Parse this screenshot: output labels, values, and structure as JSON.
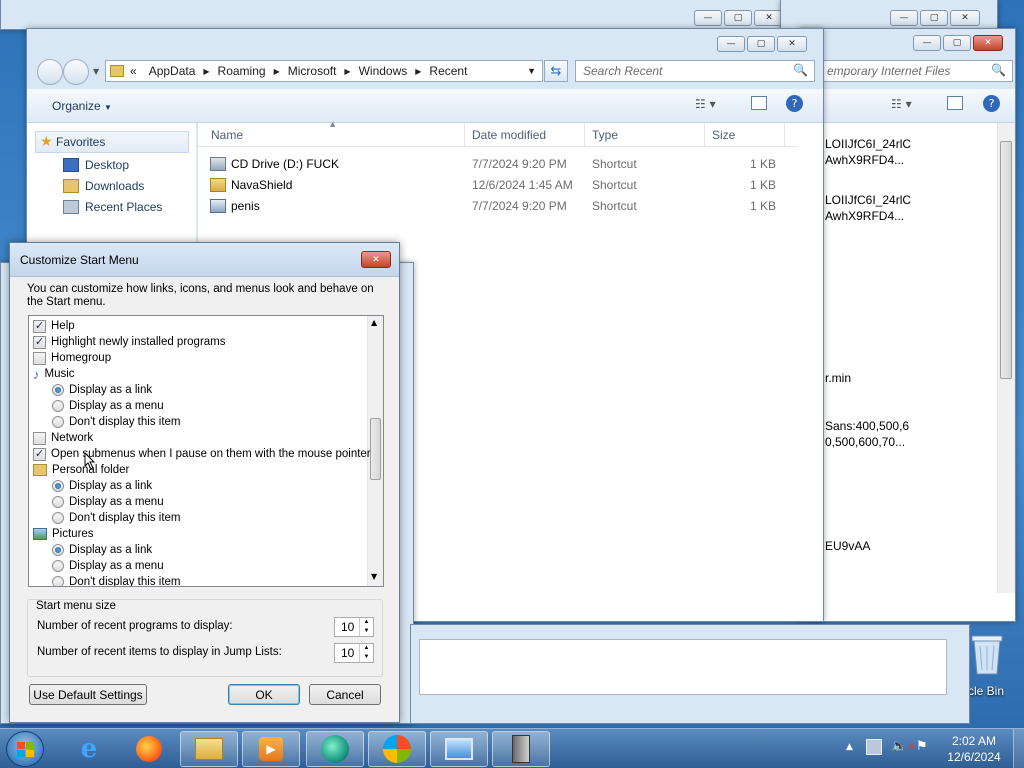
{
  "explorer": {
    "address": {
      "prefix": "«",
      "crumbs": [
        "AppData",
        "Roaming",
        "Microsoft",
        "Windows",
        "Recent"
      ]
    },
    "search_placeholder": "Search Recent",
    "organize_label": "Organize",
    "nav": {
      "favorites": "Favorites",
      "items": [
        "Desktop",
        "Downloads",
        "Recent Places"
      ]
    },
    "columns": [
      "Name",
      "Date modified",
      "Type",
      "Size"
    ],
    "files": [
      {
        "name": "CD Drive (D:) FUCK",
        "date": "7/7/2024 9:20 PM",
        "type": "Shortcut",
        "size": "1 KB"
      },
      {
        "name": "NavaShield",
        "date": "12/6/2024 1:45 AM",
        "type": "Shortcut",
        "size": "1 KB"
      },
      {
        "name": "penis",
        "date": "7/7/2024 9:20 PM",
        "type": "Shortcut",
        "size": "1 KB"
      }
    ]
  },
  "back_window": {
    "search_placeholder": "emporary Internet Files",
    "lines": [
      "LOIIJfC6I_24rlC",
      "AwhX9RFD4...",
      "LOIIJfC6I_24rlC",
      "AwhX9RFD4...",
      "r.min",
      "Sans:400,500,6",
      "0,500,600,70...",
      "EU9vAA"
    ]
  },
  "dialog": {
    "title": "Customize Start Menu",
    "description": "You can customize how links, icons, and menus look and behave on the Start menu.",
    "items": [
      {
        "kind": "check",
        "checked": true,
        "label": "Help"
      },
      {
        "kind": "check",
        "checked": true,
        "label": "Highlight newly installed programs"
      },
      {
        "kind": "check",
        "checked": false,
        "label": "Homegroup"
      },
      {
        "kind": "header",
        "icon": "music-icon",
        "label": "Music"
      },
      {
        "kind": "radio",
        "checked": true,
        "label": "Display as a link"
      },
      {
        "kind": "radio",
        "checked": false,
        "label": "Display as a menu"
      },
      {
        "kind": "radio",
        "checked": false,
        "label": "Don't display this item"
      },
      {
        "kind": "check",
        "checked": false,
        "label": "Network"
      },
      {
        "kind": "check",
        "checked": true,
        "label": "Open submenus when I pause on them with the mouse pointer"
      },
      {
        "kind": "header",
        "icon": "folder-icon",
        "label": "Personal folder"
      },
      {
        "kind": "radio",
        "checked": true,
        "label": "Display as a link"
      },
      {
        "kind": "radio",
        "checked": false,
        "label": "Display as a menu"
      },
      {
        "kind": "radio",
        "checked": false,
        "label": "Don't display this item"
      },
      {
        "kind": "header",
        "icon": "pictures-icon",
        "label": "Pictures"
      },
      {
        "kind": "radio",
        "checked": true,
        "label": "Display as a link"
      },
      {
        "kind": "radio",
        "checked": false,
        "label": "Display as a menu"
      },
      {
        "kind": "radio",
        "checked": false,
        "label": "Don't display this item"
      }
    ],
    "size_group": "Start menu size",
    "recent_programs_label": "Number of recent programs to display:",
    "recent_programs_value": "10",
    "jump_lists_label": "Number of recent items to display in Jump Lists:",
    "jump_lists_value": "10",
    "default_button": "Use Default Settings",
    "ok_button": "OK",
    "cancel_button": "Cancel"
  },
  "desktop": {
    "recycle_bin_label": "cle Bin"
  },
  "taskbar": {
    "time": "2:02 AM",
    "date": "12/6/2024",
    "apps": [
      "internet-explorer-icon",
      "firefox-icon",
      "file-explorer-icon",
      "media-player-icon",
      "browser-icon",
      "windows-icon",
      "remote-desktop-icon",
      "server-icon"
    ]
  }
}
